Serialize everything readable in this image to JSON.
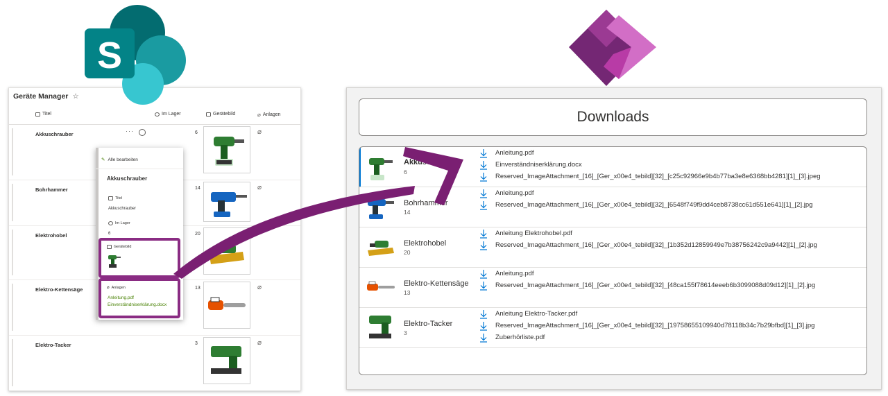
{
  "sharepoint": {
    "list_title": "Geräte Manager",
    "star": "☆",
    "columns": {
      "titel": "Titel",
      "im_lager": "Im Lager",
      "geraetebild": "Gerätebild",
      "anlagen": "Anlagen"
    },
    "rows": [
      {
        "name": "Akkuschrauber",
        "count": "6",
        "image": "drill-green"
      },
      {
        "name": "Bohrhammer",
        "count": "14",
        "image": "hammer-drill-blue"
      },
      {
        "name": "Elektrohobel",
        "count": "20",
        "image": "planer-yellow"
      },
      {
        "name": "Elektro-Kettensäge",
        "count": "13",
        "image": "chainsaw-orange"
      },
      {
        "name": "Elektro-Tacker",
        "count": "3",
        "image": "tacker-green"
      }
    ],
    "row_actions": "···",
    "popup": {
      "edit_all": "Alle bearbeiten",
      "title": "Akkuschrauber",
      "titel_label": "Titel",
      "titel_value": "Akkuschrauber",
      "lager_label": "Im Lager",
      "lager_value": "6",
      "bild_label": "Gerätebild",
      "anlagen_label": "Anlagen",
      "attachments": [
        "Anleitung.pdf",
        "Einverständniserklärung.docx"
      ]
    }
  },
  "powerapps": {
    "header": "Downloads",
    "items": [
      {
        "name": "Akkuschrauber",
        "count": "6",
        "image": "drill-green",
        "files": [
          "Anleitung.pdf",
          "Einverständniserklärung.docx",
          "Reserved_ImageAttachment_[16]_[Ger_x00e4_tebild][32]_[c25c92966e9b4b77ba3e8e6368bb4281][1]_[3].jpeg"
        ]
      },
      {
        "name": "Bohrhammer",
        "count": "14",
        "image": "hammer-drill-blue",
        "files": [
          "Anleitung.pdf",
          "Reserved_ImageAttachment_[16]_[Ger_x00e4_tebild][32]_[6548f749f9dd4ceb8738cc61d551e641][1]_[2].jpg"
        ]
      },
      {
        "name": "Elektrohobel",
        "count": "20",
        "image": "planer-yellow",
        "files": [
          "Anleitung Elektrohobel.pdf",
          "Reserved_ImageAttachment_[16]_[Ger_x00e4_tebild][32]_[1b352d12859949e7b38756242c9a9442][1]_[2].jpg"
        ]
      },
      {
        "name": "Elektro-Kettensäge",
        "count": "13",
        "image": "chainsaw-orange",
        "files": [
          "Anleitung.pdf",
          "Reserved_ImageAttachment_[16]_[Ger_x00e4_tebild][32]_[48ca155f78614eeeb6b3099088d09d12][1]_[2].jpg"
        ]
      },
      {
        "name": "Elektro-Tacker",
        "count": "3",
        "image": "tacker-green",
        "files": [
          "Anleitung Elektro-Tacker.pdf",
          "Reserved_ImageAttachment_[16]_[Ger_x00e4_tebild][32]_[19758655109940d78118b34c7b29bfbd][1]_[3].jpg",
          "Zuberhörliste.pdf"
        ]
      }
    ]
  },
  "colors": {
    "arrow": "#7a1f72",
    "sharepoint_teal": "#038387",
    "powerapps_magenta": "#b83ba6",
    "accent_blue": "#0078d4",
    "attachment_green": "#498205"
  }
}
